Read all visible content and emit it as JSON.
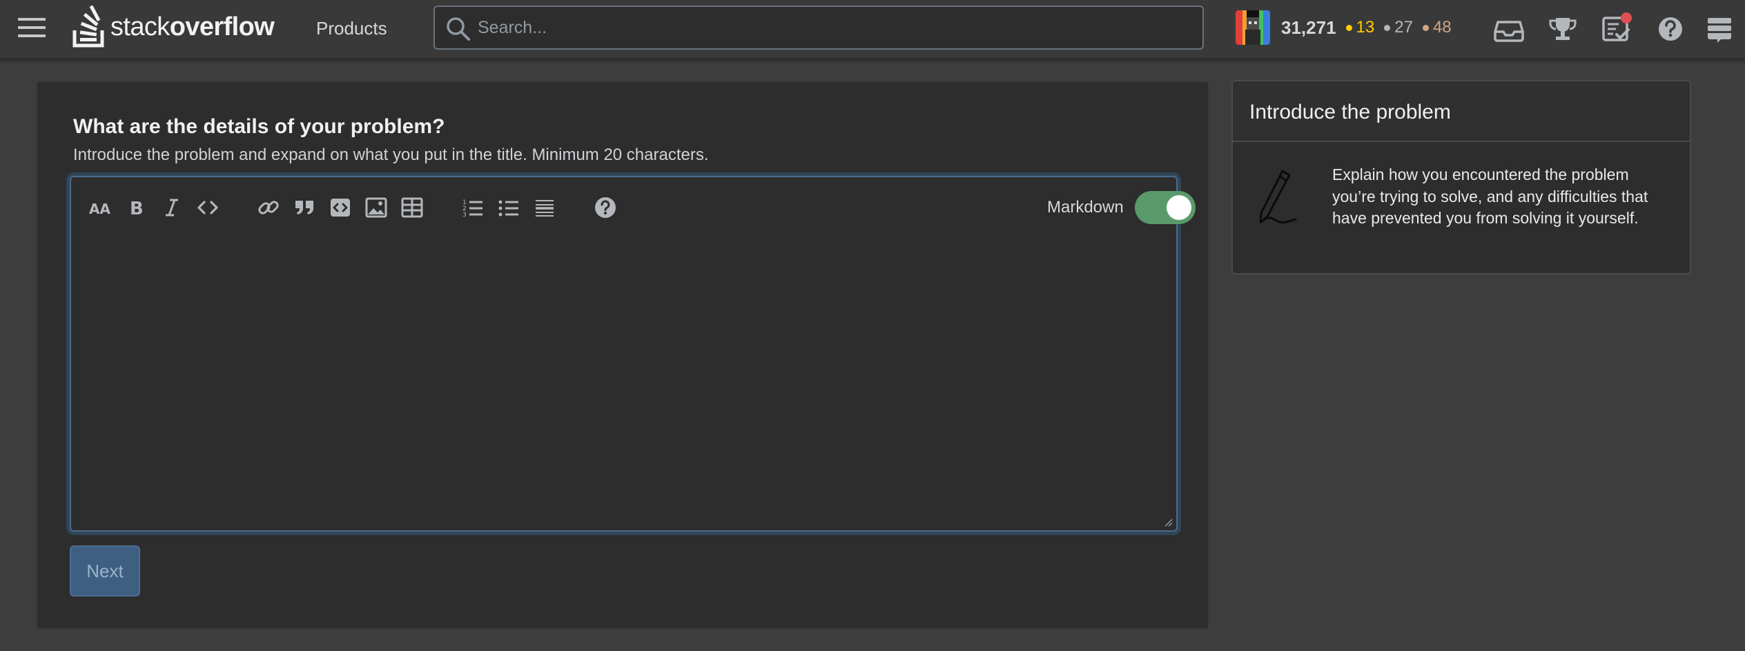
{
  "header": {
    "logo_text_light": "stack",
    "logo_text_bold": "overflow",
    "products_label": "Products",
    "search_placeholder": "Search...",
    "user": {
      "reputation": "31,271",
      "gold_badges": "13",
      "silver_badges": "27",
      "bronze_badges": "48"
    },
    "icons": [
      "inbox-icon",
      "achievements-icon",
      "review-queues-icon",
      "help-icon",
      "site-switcher-icon"
    ]
  },
  "form": {
    "title": "What are the details of your problem?",
    "subtitle": "Introduce the problem and expand on what you put in the title. Minimum 20 characters.",
    "editor": {
      "toolbar": [
        "heading-icon",
        "bold-icon",
        "italic-icon",
        "code-icon",
        "link-icon",
        "blockquote-icon",
        "code-block-icon",
        "image-icon",
        "table-icon",
        "ordered-list-icon",
        "unordered-list-icon",
        "horizontal-rule-icon",
        "help-icon"
      ],
      "markdown_label": "Markdown",
      "markdown_enabled": true,
      "body_value": ""
    },
    "next_label": "Next"
  },
  "sidebar": {
    "title": "Introduce the problem",
    "body": "Explain how you encountered the problem you’re trying to solve, and any difficulties that have prevented you from solving it yourself."
  },
  "colors": {
    "background": "#3d3d3d",
    "card": "#2d2d2d",
    "accent_blue": "#3e5f82",
    "toggle_green": "#5a9a6a",
    "badge_gold": "#ffcc01",
    "badge_silver": "#b4b8bc",
    "badge_bronze": "#d1a684",
    "notification_red": "#de4f54"
  }
}
